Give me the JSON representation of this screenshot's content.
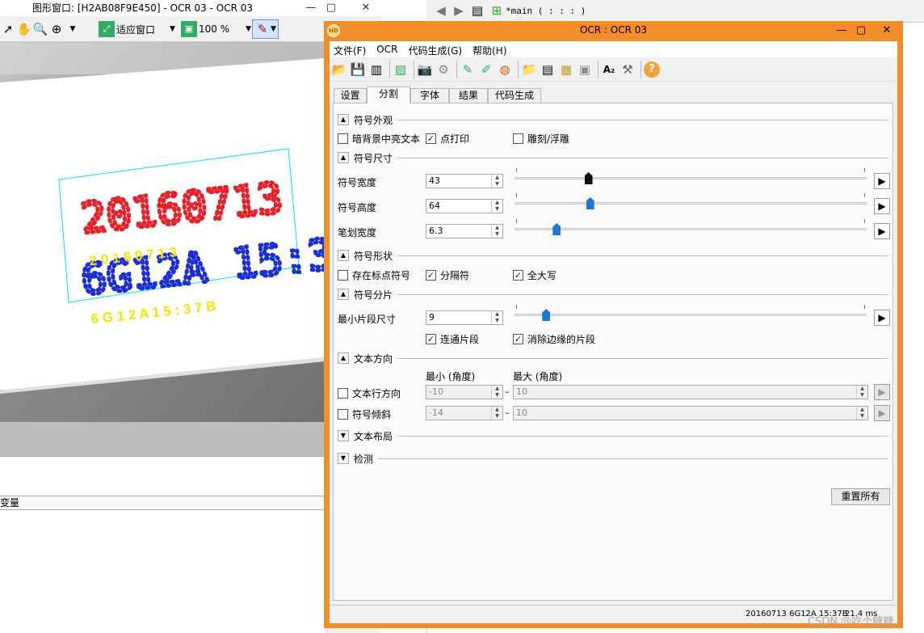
{
  "graphics_window": {
    "title": "图形窗口: [H2AB08F9E450] - OCR 03 - OCR 03",
    "minimize": "—",
    "close": "✕",
    "toolbar": {
      "fit_label": "适应窗口",
      "zoom_value": "100 %"
    },
    "bottom_label": "变量"
  },
  "background_editor": {
    "main_label": "*main ( : : : )"
  },
  "ocr_dialog": {
    "title": "OCR : OCR 03",
    "logo_text": "HD",
    "menu": [
      "文件(F)",
      "OCR",
      "代码生成(G)",
      "帮助(H)"
    ],
    "tabs": [
      "设置",
      "分割",
      "字体",
      "结果",
      "代码生成"
    ],
    "active_tab": "分割",
    "sections": {
      "appearance": "符号外观",
      "size": "符号尺寸",
      "shape": "符号形状",
      "fragments": "符号分片",
      "direction": "文本方向",
      "layout": "文本布局",
      "detect": "检测"
    },
    "appearance": {
      "dark_bg": "暗背景中亮文本",
      "dot_print": "点打印",
      "engraved": "雕刻/浮雕"
    },
    "size": {
      "width_label": "符号宽度",
      "width_value": "43",
      "height_label": "符号高度",
      "height_value": "64",
      "stroke_label": "笔划宽度",
      "stroke_value": "6.3",
      "width_level": 0.21,
      "height_level": 0.215,
      "stroke_level": 0.12
    },
    "shape": {
      "punct": "存在标点符号",
      "separator": "分隔符",
      "uppercase": "全大写"
    },
    "fragments": {
      "min_label": "最小片段尺寸",
      "min_value": "9",
      "min_level": 0.09,
      "connect": "连通片段",
      "remove_border": "消除边缘的片段"
    },
    "direction": {
      "min_header": "最小 (角度)",
      "max_header": "最大 (角度)",
      "line_dir": "文本行方向",
      "line_min": "-10",
      "line_max": "10",
      "slant": "符号倾斜",
      "slant_min": "-14",
      "slant_max": "10"
    },
    "reset_label": "重置所有",
    "status_text": "20160713 6G12A 15:37B",
    "status_time": "21.4 ms"
  },
  "canvas_text": {
    "line1": "20160713",
    "line2": "6G12A 15:37B",
    "yellow1": "2 0 1 6 0 7 1 3",
    "yellow2": "6 G 1 2 A   1 5 : 3 7 B"
  },
  "watermark": "CSDN @吃个糖糖",
  "colors": {
    "dialog_frame": "#f28d2a",
    "slider_thumb": "#1f78d6",
    "canvas_box": "#00e5e5",
    "red": "#e8202a",
    "green": "#1ed21e",
    "blue": "#1a2fd8",
    "yellow": "#f2e600"
  }
}
